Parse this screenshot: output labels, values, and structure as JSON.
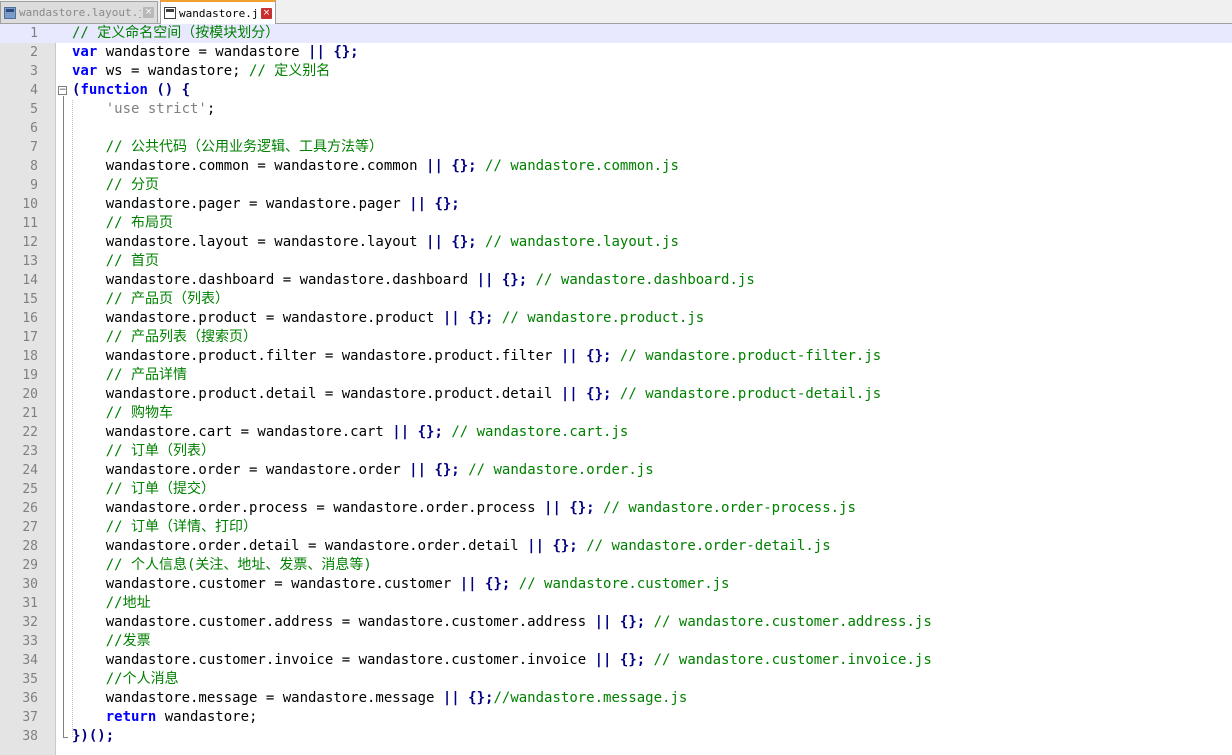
{
  "tabs": [
    {
      "label": "wandastore.layout.js",
      "active": false,
      "icon": "js-file-icon",
      "close": "×"
    },
    {
      "label": "wandastore.js",
      "active": true,
      "icon": "js-file-icon",
      "close": "×"
    }
  ],
  "colors": {
    "keyword": "#0000ff",
    "operator": "#000080",
    "comment": "#008000",
    "string": "#808080",
    "current_line": "#e8e8ff"
  },
  "fold_markers": {
    "open": "⊟",
    "end": "└"
  },
  "code_lines": [
    {
      "n": "1",
      "tokens": [
        [
          "cm",
          "// 定义命名空间（按模块划分）"
        ]
      ]
    },
    {
      "n": "2",
      "tokens": [
        [
          "kw",
          "var"
        ],
        [
          "t",
          " wandastore = wandastore "
        ],
        [
          "op",
          "||"
        ],
        [
          "t",
          " "
        ],
        [
          "op",
          "{};"
        ]
      ]
    },
    {
      "n": "3",
      "tokens": [
        [
          "kw",
          "var"
        ],
        [
          "t",
          " ws = wandastore; "
        ],
        [
          "cm",
          "// 定义别名"
        ]
      ]
    },
    {
      "n": "4",
      "tokens": [
        [
          "op",
          "("
        ],
        [
          "kw",
          "function"
        ],
        [
          "t",
          " "
        ],
        [
          "op",
          "() {"
        ]
      ]
    },
    {
      "n": "5",
      "tokens": [
        [
          "t",
          "    "
        ],
        [
          "str",
          "'use strict'"
        ],
        [
          "t",
          ";"
        ]
      ]
    },
    {
      "n": "6",
      "tokens": []
    },
    {
      "n": "7",
      "tokens": [
        [
          "t",
          "    "
        ],
        [
          "cm",
          "// 公共代码（公用业务逻辑、工具方法等）"
        ]
      ]
    },
    {
      "n": "8",
      "tokens": [
        [
          "t",
          "    wandastore.common = wandastore.common "
        ],
        [
          "op",
          "||"
        ],
        [
          "t",
          " "
        ],
        [
          "op",
          "{};"
        ],
        [
          "t",
          " "
        ],
        [
          "cm",
          "// wandastore.common.js"
        ]
      ]
    },
    {
      "n": "9",
      "tokens": [
        [
          "t",
          "    "
        ],
        [
          "cm",
          "// 分页"
        ]
      ]
    },
    {
      "n": "10",
      "tokens": [
        [
          "t",
          "    wandastore.pager = wandastore.pager "
        ],
        [
          "op",
          "||"
        ],
        [
          "t",
          " "
        ],
        [
          "op",
          "{};"
        ]
      ]
    },
    {
      "n": "11",
      "tokens": [
        [
          "t",
          "    "
        ],
        [
          "cm",
          "// 布局页"
        ]
      ]
    },
    {
      "n": "12",
      "tokens": [
        [
          "t",
          "    wandastore.layout = wandastore.layout "
        ],
        [
          "op",
          "||"
        ],
        [
          "t",
          " "
        ],
        [
          "op",
          "{};"
        ],
        [
          "t",
          " "
        ],
        [
          "cm",
          "// wandastore.layout.js"
        ]
      ]
    },
    {
      "n": "13",
      "tokens": [
        [
          "t",
          "    "
        ],
        [
          "cm",
          "// 首页"
        ]
      ]
    },
    {
      "n": "14",
      "tokens": [
        [
          "t",
          "    wandastore.dashboard = wandastore.dashboard "
        ],
        [
          "op",
          "||"
        ],
        [
          "t",
          " "
        ],
        [
          "op",
          "{};"
        ],
        [
          "t",
          " "
        ],
        [
          "cm",
          "// wandastore.dashboard.js"
        ]
      ]
    },
    {
      "n": "15",
      "tokens": [
        [
          "t",
          "    "
        ],
        [
          "cm",
          "// 产品页（列表）"
        ]
      ]
    },
    {
      "n": "16",
      "tokens": [
        [
          "t",
          "    wandastore.product = wandastore.product "
        ],
        [
          "op",
          "||"
        ],
        [
          "t",
          " "
        ],
        [
          "op",
          "{};"
        ],
        [
          "t",
          " "
        ],
        [
          "cm",
          "// wandastore.product.js"
        ]
      ]
    },
    {
      "n": "17",
      "tokens": [
        [
          "t",
          "    "
        ],
        [
          "cm",
          "// 产品列表（搜索页）"
        ]
      ]
    },
    {
      "n": "18",
      "tokens": [
        [
          "t",
          "    wandastore.product.filter = wandastore.product.filter "
        ],
        [
          "op",
          "||"
        ],
        [
          "t",
          " "
        ],
        [
          "op",
          "{};"
        ],
        [
          "t",
          " "
        ],
        [
          "cm",
          "// wandastore.product-filter.js"
        ]
      ]
    },
    {
      "n": "19",
      "tokens": [
        [
          "t",
          "    "
        ],
        [
          "cm",
          "// 产品详情"
        ]
      ]
    },
    {
      "n": "20",
      "tokens": [
        [
          "t",
          "    wandastore.product.detail = wandastore.product.detail "
        ],
        [
          "op",
          "||"
        ],
        [
          "t",
          " "
        ],
        [
          "op",
          "{};"
        ],
        [
          "t",
          " "
        ],
        [
          "cm",
          "// wandastore.product-detail.js"
        ]
      ]
    },
    {
      "n": "21",
      "tokens": [
        [
          "t",
          "    "
        ],
        [
          "cm",
          "// 购物车"
        ]
      ]
    },
    {
      "n": "22",
      "tokens": [
        [
          "t",
          "    wandastore.cart = wandastore.cart "
        ],
        [
          "op",
          "||"
        ],
        [
          "t",
          " "
        ],
        [
          "op",
          "{};"
        ],
        [
          "t",
          " "
        ],
        [
          "cm",
          "// wandastore.cart.js"
        ]
      ]
    },
    {
      "n": "23",
      "tokens": [
        [
          "t",
          "    "
        ],
        [
          "cm",
          "// 订单（列表）"
        ]
      ]
    },
    {
      "n": "24",
      "tokens": [
        [
          "t",
          "    wandastore.order = wandastore.order "
        ],
        [
          "op",
          "||"
        ],
        [
          "t",
          " "
        ],
        [
          "op",
          "{};"
        ],
        [
          "t",
          " "
        ],
        [
          "cm",
          "// wandastore.order.js"
        ]
      ]
    },
    {
      "n": "25",
      "tokens": [
        [
          "t",
          "    "
        ],
        [
          "cm",
          "// 订单（提交）"
        ]
      ]
    },
    {
      "n": "26",
      "tokens": [
        [
          "t",
          "    wandastore.order.process = wandastore.order.process "
        ],
        [
          "op",
          "||"
        ],
        [
          "t",
          " "
        ],
        [
          "op",
          "{};"
        ],
        [
          "t",
          " "
        ],
        [
          "cm",
          "// wandastore.order-process.js"
        ]
      ]
    },
    {
      "n": "27",
      "tokens": [
        [
          "t",
          "    "
        ],
        [
          "cm",
          "// 订单（详情、打印）"
        ]
      ]
    },
    {
      "n": "28",
      "tokens": [
        [
          "t",
          "    wandastore.order.detail = wandastore.order.detail "
        ],
        [
          "op",
          "||"
        ],
        [
          "t",
          " "
        ],
        [
          "op",
          "{};"
        ],
        [
          "t",
          " "
        ],
        [
          "cm",
          "// wandastore.order-detail.js"
        ]
      ]
    },
    {
      "n": "29",
      "tokens": [
        [
          "t",
          "    "
        ],
        [
          "cm",
          "// 个人信息(关注、地址、发票、消息等)"
        ]
      ]
    },
    {
      "n": "30",
      "tokens": [
        [
          "t",
          "    wandastore.customer = wandastore.customer "
        ],
        [
          "op",
          "||"
        ],
        [
          "t",
          " "
        ],
        [
          "op",
          "{};"
        ],
        [
          "t",
          " "
        ],
        [
          "cm",
          "// wandastore.customer.js"
        ]
      ]
    },
    {
      "n": "31",
      "tokens": [
        [
          "t",
          "    "
        ],
        [
          "cm",
          "//地址"
        ]
      ]
    },
    {
      "n": "32",
      "tokens": [
        [
          "t",
          "    wandastore.customer.address = wandastore.customer.address "
        ],
        [
          "op",
          "||"
        ],
        [
          "t",
          " "
        ],
        [
          "op",
          "{};"
        ],
        [
          "t",
          " "
        ],
        [
          "cm",
          "// wandastore.customer.address.js"
        ]
      ]
    },
    {
      "n": "33",
      "tokens": [
        [
          "t",
          "    "
        ],
        [
          "cm",
          "//发票"
        ]
      ]
    },
    {
      "n": "34",
      "tokens": [
        [
          "t",
          "    wandastore.customer.invoice = wandastore.customer.invoice "
        ],
        [
          "op",
          "||"
        ],
        [
          "t",
          " "
        ],
        [
          "op",
          "{};"
        ],
        [
          "t",
          " "
        ],
        [
          "cm",
          "// wandastore.customer.invoice.js"
        ]
      ]
    },
    {
      "n": "35",
      "tokens": [
        [
          "t",
          "    "
        ],
        [
          "cm",
          "//个人消息"
        ]
      ]
    },
    {
      "n": "36",
      "tokens": [
        [
          "t",
          "    wandastore.message = wandastore.message "
        ],
        [
          "op",
          "||"
        ],
        [
          "t",
          " "
        ],
        [
          "op",
          "{};"
        ],
        [
          "cm",
          "//wandastore.message.js"
        ]
      ]
    },
    {
      "n": "37",
      "tokens": [
        [
          "t",
          "    "
        ],
        [
          "kw",
          "return"
        ],
        [
          "t",
          " wandastore;"
        ]
      ]
    },
    {
      "n": "38",
      "tokens": [
        [
          "op",
          "})();"
        ]
      ]
    }
  ]
}
